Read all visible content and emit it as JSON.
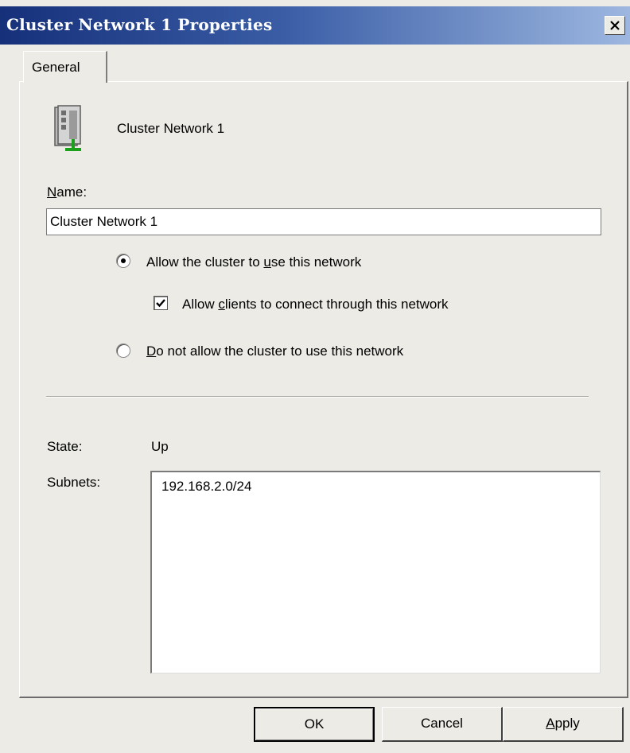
{
  "window": {
    "title": "Cluster Network 1 Properties"
  },
  "tabs": [
    {
      "label": "General"
    }
  ],
  "header": {
    "network_name": "Cluster Network 1",
    "icon": "server-network-icon"
  },
  "name_field": {
    "label_ul": "N",
    "label_rest": "ame:",
    "value": "Cluster Network 1"
  },
  "options": {
    "allow_cluster": {
      "pre": "Allow the cluster to ",
      "ul": "u",
      "post": "se this network",
      "selected": true
    },
    "allow_clients": {
      "pre": "Allow ",
      "ul": "c",
      "post": "lients to connect through this network",
      "checked": true
    },
    "disallow_cluster": {
      "pre": "",
      "ul": "D",
      "post": "o not allow the cluster to use this network",
      "selected": false
    }
  },
  "state": {
    "label": "State:",
    "value": "Up"
  },
  "subnets": {
    "label": "Subnets:",
    "items": [
      "192.168.2.0/24"
    ]
  },
  "buttons": {
    "ok": "OK",
    "cancel": "Cancel",
    "apply_ul": "A",
    "apply_rest": "pply"
  },
  "colors": {
    "title_bar_start": "#16307a",
    "title_bar_end": "#9db7e0",
    "dialog_bg": "#ecebe6"
  }
}
